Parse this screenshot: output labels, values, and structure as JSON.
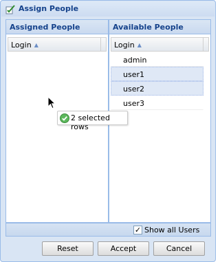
{
  "window": {
    "title": "Assign People"
  },
  "assigned": {
    "header": "Assigned People",
    "column": "Login",
    "rows": []
  },
  "available": {
    "header": "Available People",
    "column": "Login",
    "rows": [
      {
        "login": "admin",
        "selected": false
      },
      {
        "login": "user1",
        "selected": true
      },
      {
        "login": "user2",
        "selected": true
      },
      {
        "login": "user3",
        "selected": false
      }
    ]
  },
  "footer": {
    "show_all_label": "Show all Users",
    "show_all_checked": true
  },
  "buttons": {
    "reset": "Reset",
    "accept": "Accept",
    "cancel": "Cancel"
  },
  "drag_tooltip": {
    "text": "2 selected rows",
    "icon": "check-circle-icon"
  },
  "colors": {
    "accent": "#15428b",
    "selection": "#dfe8f6",
    "ok": "#5cb85c"
  }
}
